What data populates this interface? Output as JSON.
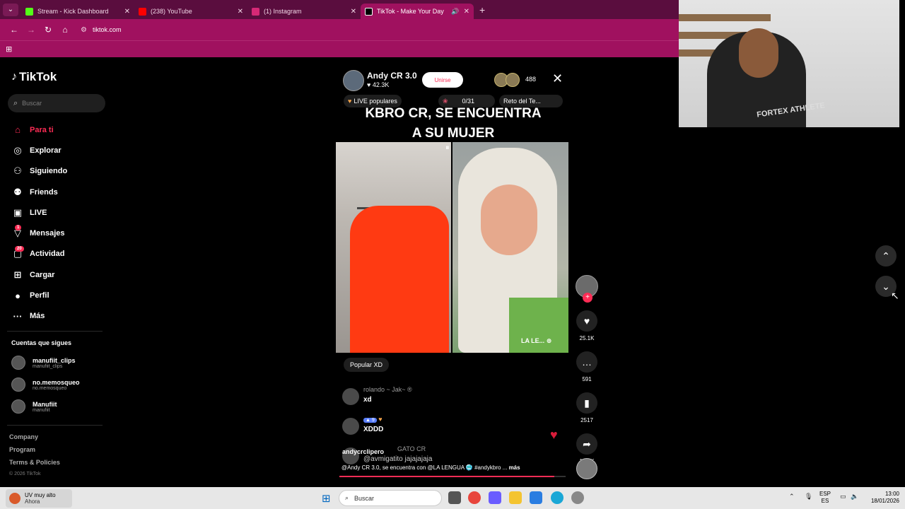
{
  "browser": {
    "tabs": [
      {
        "title": "Stream - Kick Dashboard",
        "fav_color": "#53fc18",
        "active": false
      },
      {
        "title": "(238) YouTube",
        "fav_color": "#ff0000",
        "active": false
      },
      {
        "title": "(1) Instagram",
        "fav_color": "#d62976",
        "active": false
      },
      {
        "title": "TikTok - Make Your Day",
        "fav_color": "#000000",
        "active": true
      }
    ],
    "url": "tiktok.com"
  },
  "sidebar": {
    "logo": "TikTok",
    "search_placeholder": "Buscar",
    "menu": [
      {
        "label": "Para ti",
        "icon": "home-icon",
        "active": true,
        "badge": ""
      },
      {
        "label": "Explorar",
        "icon": "compass-icon",
        "active": false,
        "badge": ""
      },
      {
        "label": "Siguiendo",
        "icon": "following-icon",
        "active": false,
        "badge": ""
      },
      {
        "label": "Friends",
        "icon": "friends-icon",
        "active": false,
        "badge": ""
      },
      {
        "label": "LIVE",
        "icon": "live-icon",
        "active": false,
        "badge": ""
      },
      {
        "label": "Mensajes",
        "icon": "messages-icon",
        "active": false,
        "badge": "1"
      },
      {
        "label": "Actividad",
        "icon": "activity-icon",
        "active": false,
        "badge": "20"
      },
      {
        "label": "Cargar",
        "icon": "upload-icon",
        "active": false,
        "badge": ""
      },
      {
        "label": "Perfil",
        "icon": "profile-icon",
        "active": false,
        "badge": ""
      },
      {
        "label": "Más",
        "icon": "more-icon",
        "active": false,
        "badge": ""
      }
    ],
    "following_title": "Cuentas que sigues",
    "following": [
      {
        "name": "manufiit_clips",
        "handle": "manufiit_clips"
      },
      {
        "name": "no.memosqueo",
        "handle": "no.memosqueo"
      },
      {
        "name": "Manufiit",
        "handle": "manufiit"
      }
    ],
    "footer": [
      "Company",
      "Program",
      "Terms & Policies"
    ],
    "copyright": "© 2026 TikTok"
  },
  "live": {
    "host_name": "Andy CR 3.0",
    "host_likes": "♥ 42.3K",
    "join_label": "Unirse",
    "viewer_count": "488",
    "pills": [
      "LIVE populares",
      "0/31",
      "Reto del Te..."
    ],
    "headline_1": "KBRO CR, SE ENCUENTRA",
    "headline_2": "A SU MUJER",
    "guest_label": "LA LE...",
    "popular_chip": "Popular XD",
    "chat": [
      {
        "name": "rolando ~ Jak~ ®",
        "text": "xd",
        "level": ""
      },
      {
        "name": "",
        "text": "XDDD",
        "level": "9"
      },
      {
        "name": "GATO CR",
        "text": "@avmigatito jajajajaja",
        "level": ""
      }
    ],
    "caption_user": "andycrclipero",
    "caption": "@Andy CR 3.0, se encuentra con @LA LENGUA 🥶 #andykbro ...",
    "caption_more": "más",
    "progress": 0.95
  },
  "actions": {
    "likes": "25.1K",
    "comments": "591",
    "saves": "2517",
    "shares": "18.3K"
  },
  "webcam": {
    "shirt_text": "FORTEX ATHLETE"
  },
  "taskbar": {
    "weather_title": "UV muy alto",
    "weather_sub": "Ahora",
    "search_label": "Buscar",
    "lang_1": "ESP",
    "lang_2": "ES",
    "time": "13:00",
    "date": "18/01/2026"
  }
}
